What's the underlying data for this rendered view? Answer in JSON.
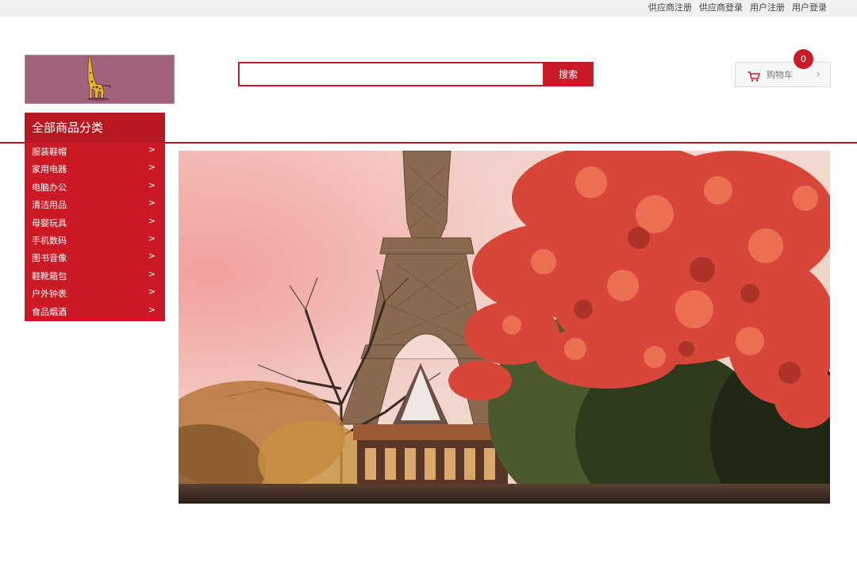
{
  "topbar": {
    "links": [
      "供应商注册",
      "供应商登录",
      "用户注册",
      "用户登录"
    ]
  },
  "search": {
    "value": "",
    "placeholder": "",
    "button_label": "搜索"
  },
  "cart": {
    "label": "购物车",
    "count": "0",
    "arrow": "›"
  },
  "categories": {
    "header": "全部商品分类",
    "items": [
      "服装鞋帽",
      "家用电器",
      "电脑办公",
      "清洁用品",
      "母婴玩具",
      "手机数码",
      "图书音像",
      "鞋靴箱包",
      "户外钟表",
      "食品烟酒"
    ],
    "chevron": ">"
  },
  "colors": {
    "accent": "#c81b27",
    "category_bg": "#cb1a25",
    "logo_bg": "#a2617c"
  },
  "icons": {
    "cart": "shopping-cart-icon",
    "chevron": "chevron-right-icon"
  }
}
